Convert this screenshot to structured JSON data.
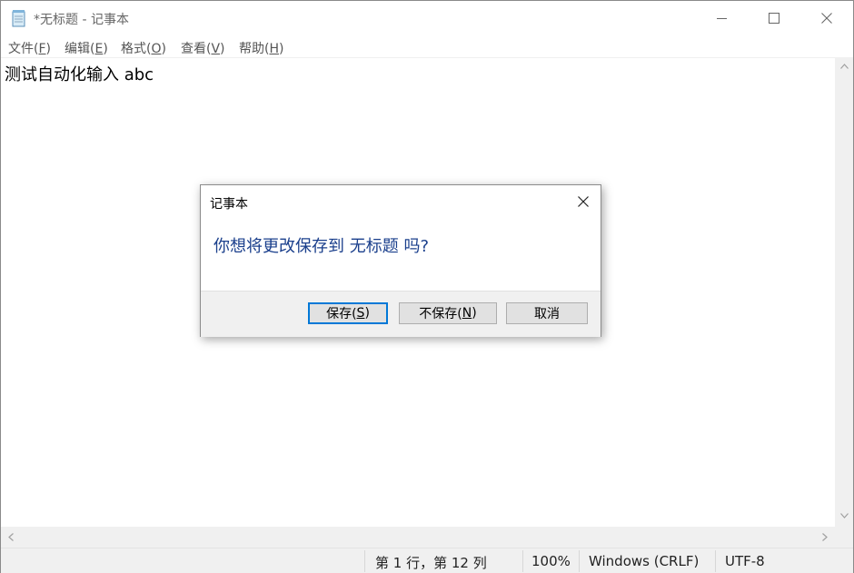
{
  "window": {
    "title": "*无标题 - 记事本"
  },
  "menu": [
    {
      "label": "文件(",
      "accel": "F",
      "close": ")"
    },
    {
      "label": "编辑(",
      "accel": "E",
      "close": ")"
    },
    {
      "label": "格式(",
      "accel": "O",
      "close": ")"
    },
    {
      "label": "查看(",
      "accel": "V",
      "close": ")"
    },
    {
      "label": "帮助(",
      "accel": "H",
      "close": ")"
    }
  ],
  "editor": {
    "content": "测试自动化输入 abc"
  },
  "status": {
    "position": "第 1 行，第 12 列",
    "zoom": "100%",
    "line_ending": "Windows (CRLF)",
    "encoding": "UTF-8"
  },
  "dialog": {
    "title": "记事本",
    "message": "你想将更改保存到 无标题 吗?",
    "buttons": {
      "save": {
        "label": "保存(",
        "accel": "S",
        "close": ")"
      },
      "dont_save": {
        "label": "不保存(",
        "accel": "N",
        "close": ")"
      },
      "cancel": {
        "label": "取消"
      }
    }
  },
  "colors": {
    "dialog_message": "#1a3f8c",
    "default_button_border": "#0078d7"
  }
}
